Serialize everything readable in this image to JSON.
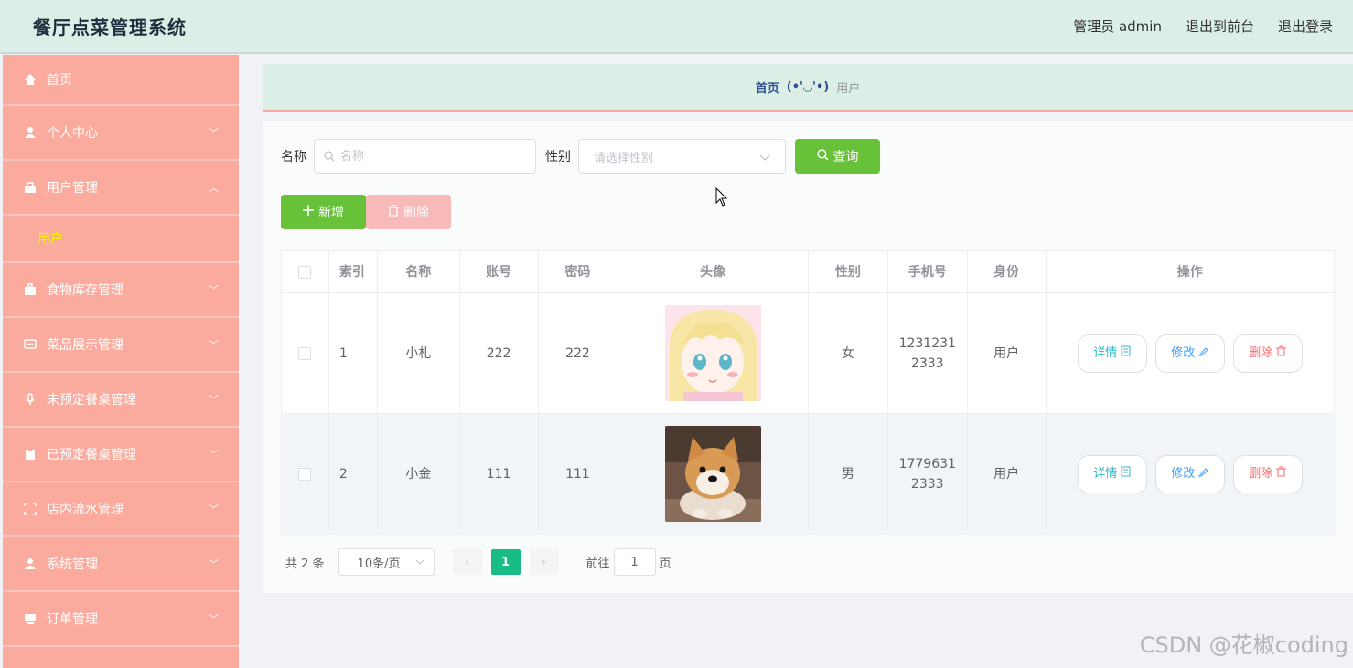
{
  "header": {
    "title": "餐厅点菜管理系统",
    "admin_label": "管理员 admin",
    "exit_front": "退出到前台",
    "logout": "退出登录"
  },
  "sidebar": {
    "items": [
      {
        "label": "首页",
        "icon": "home-icon"
      },
      {
        "label": "个人中心",
        "icon": "user-icon"
      },
      {
        "label": "用户管理",
        "icon": "user-manage-icon",
        "expanded": true,
        "children": [
          {
            "label": "用户"
          }
        ]
      },
      {
        "label": "食物库存管理",
        "icon": "briefcase-icon"
      },
      {
        "label": "菜品展示管理",
        "icon": "chat-icon"
      },
      {
        "label": "未预定餐桌管理",
        "icon": "microphone-icon"
      },
      {
        "label": "已预定餐桌管理",
        "icon": "clipboard-icon"
      },
      {
        "label": "店内流水管理",
        "icon": "frame-icon"
      },
      {
        "label": "系统管理",
        "icon": "user-icon"
      },
      {
        "label": "订单管理",
        "icon": "monitor-icon"
      }
    ]
  },
  "breadcrumb": {
    "home": "首页",
    "face": "(•'◡'•)",
    "current": "用户"
  },
  "search": {
    "name_label": "名称",
    "name_placeholder": "名称",
    "gender_label": "性别",
    "gender_placeholder": "请选择性别",
    "query_label": "查询"
  },
  "actions": {
    "add_label": "新增",
    "delete_label": "删除"
  },
  "table": {
    "columns": [
      "索引",
      "名称",
      "账号",
      "密码",
      "头像",
      "性别",
      "手机号",
      "身份",
      "操作"
    ],
    "rows": [
      {
        "index": "1",
        "name": "小札",
        "account": "222",
        "password": "222",
        "avatar": "anime-girl-avatar",
        "gender": "女",
        "phone_line1": "1231231",
        "phone_line2": "2333",
        "role": "用户"
      },
      {
        "index": "2",
        "name": "小金",
        "account": "111",
        "password": "111",
        "avatar": "shiba-dog-avatar",
        "gender": "男",
        "phone_line1": "1779631",
        "phone_line2": "2333",
        "role": "用户"
      }
    ],
    "op_detail": "详情",
    "op_edit": "修改",
    "op_delete": "删除"
  },
  "pagination": {
    "total": "共 2 条",
    "page_size": "10条/页",
    "current_page": "1",
    "goto_label": "前往",
    "goto_value": "1",
    "goto_suffix": "页"
  },
  "watermark": "CSDN @花椒coding",
  "colors": {
    "sidebar_bg": "#fbab9e",
    "header_bg": "#dcefe6",
    "primary_green": "#67c23a",
    "page_active": "#18bc85",
    "submenu_active": "#f7f400"
  }
}
